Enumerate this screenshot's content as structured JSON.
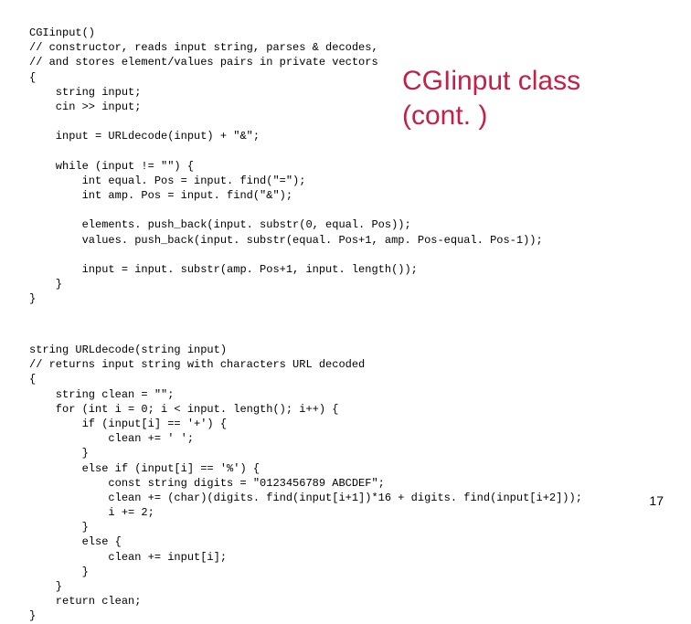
{
  "title_line1": "CGIinput class",
  "title_line2": "(cont. )",
  "page_number": "17",
  "code_block_1": "CGIinput()\n// constructor, reads input string, parses & decodes,\n// and stores element/values pairs in private vectors\n{\n    string input;\n    cin >> input;\n\n    input = URLdecode(input) + \"&\";\n\n    while (input != \"\") {\n        int equal. Pos = input. find(\"=\");\n        int amp. Pos = input. find(\"&\");\n\n        elements. push_back(input. substr(0, equal. Pos));\n        values. push_back(input. substr(equal. Pos+1, amp. Pos-equal. Pos-1));\n\n        input = input. substr(amp. Pos+1, input. length());\n    }\n}",
  "code_block_2": "string URLdecode(string input)\n// returns input string with characters URL decoded\n{\n    string clean = \"\";\n    for (int i = 0; i < input. length(); i++) {\n        if (input[i] == '+') {\n            clean += ' ';\n        }\n        else if (input[i] == '%') {\n            const string digits = \"0123456789 ABCDEF\";\n            clean += (char)(digits. find(input[i+1])*16 + digits. find(input[i+2]));\n            i += 2;\n        }\n        else {\n            clean += input[i];\n        }\n    }\n    return clean;\n}"
}
